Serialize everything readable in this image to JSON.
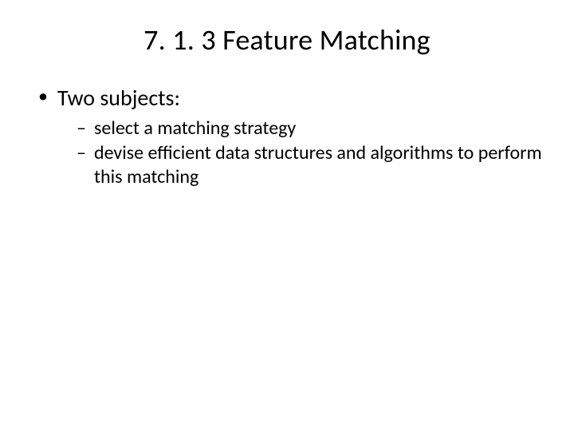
{
  "title": "7. 1. 3 Feature Matching",
  "bullets": {
    "item1": {
      "text": "Two subjects:",
      "subitems": {
        "s1": "select a matching strategy",
        "s2": "devise efficient data structures and algorithms to perform this matching"
      }
    }
  }
}
